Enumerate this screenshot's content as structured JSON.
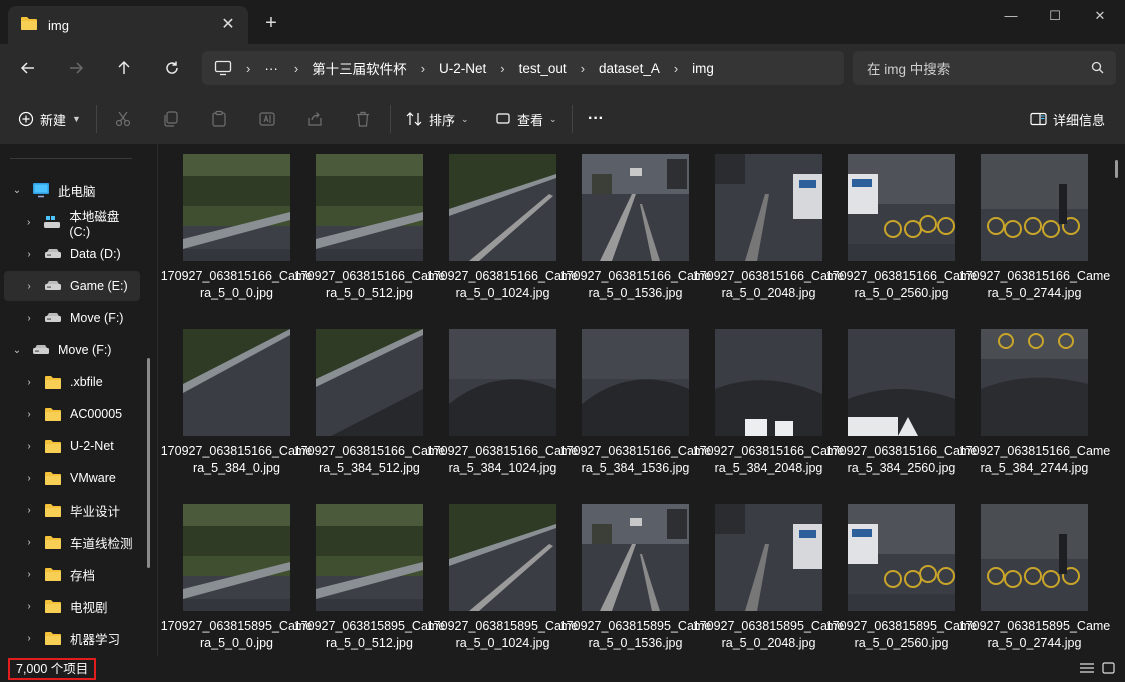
{
  "window": {
    "tab_title": "img",
    "close_tab": "✕",
    "new_tab": "+",
    "minimize": "—",
    "maximize": "☐",
    "close": "✕"
  },
  "address": {
    "more": "···",
    "breadcrumbs": [
      "第十三届软件杯",
      "U-2-Net",
      "test_out",
      "dataset_A",
      "img"
    ],
    "separator": "›"
  },
  "search": {
    "placeholder": "在 img 中搜索"
  },
  "toolbar": {
    "new_label": "新建",
    "sort_label": "排序",
    "view_label": "查看",
    "more": "···",
    "details_label": "详细信息"
  },
  "sidebar": {
    "items": [
      {
        "label": "此电脑",
        "chev": "⌄",
        "icon": "computer"
      },
      {
        "label": "本地磁盘 (C:)",
        "chev": "›",
        "icon": "win-drive"
      },
      {
        "label": "Data (D:)",
        "chev": "›",
        "icon": "drive"
      },
      {
        "label": "Game (E:)",
        "chev": "›",
        "icon": "drive"
      },
      {
        "label": "Move (F:)",
        "chev": "›",
        "icon": "drive"
      },
      {
        "label": "Move (F:)",
        "chev": "⌄",
        "icon": "drive"
      },
      {
        "label": ".xbfile",
        "chev": "›",
        "icon": "folder"
      },
      {
        "label": "AC00005",
        "chev": "›",
        "icon": "folder"
      },
      {
        "label": "U-2-Net",
        "chev": "›",
        "icon": "folder"
      },
      {
        "label": "VMware",
        "chev": "›",
        "icon": "folder"
      },
      {
        "label": "毕业设计",
        "chev": "›",
        "icon": "folder"
      },
      {
        "label": "车道线检测",
        "chev": "›",
        "icon": "folder"
      },
      {
        "label": "存档",
        "chev": "›",
        "icon": "folder"
      },
      {
        "label": "电视剧",
        "chev": "›",
        "icon": "folder"
      },
      {
        "label": "机器学习",
        "chev": "›",
        "icon": "folder"
      }
    ]
  },
  "files": [
    {
      "name": "170927_063815166_Camera_5_0_0.jpg",
      "scene": "grass"
    },
    {
      "name": "170927_063815166_Camera_5_0_512.jpg",
      "scene": "grass"
    },
    {
      "name": "170927_063815166_Camera_5_0_1024.jpg",
      "scene": "road-left"
    },
    {
      "name": "170927_063815166_Camera_5_0_1536.jpg",
      "scene": "road"
    },
    {
      "name": "170927_063815166_Camera_5_0_2048.jpg",
      "scene": "street"
    },
    {
      "name": "170927_063815166_Camera_5_0_2560.jpg",
      "scene": "bikes"
    },
    {
      "name": "170927_063815166_Camera_5_0_2744.jpg",
      "scene": "bikes2"
    },
    {
      "name": "170927_063815166_Camera_5_384_0.jpg",
      "scene": "curb"
    },
    {
      "name": "170927_063815166_Camera_5_384_512.jpg",
      "scene": "curb-hood"
    },
    {
      "name": "170927_063815166_Camera_5_384_1024.jpg",
      "scene": "hood"
    },
    {
      "name": "170927_063815166_Camera_5_384_1536.jpg",
      "scene": "hood"
    },
    {
      "name": "170927_063815166_Camera_5_384_2048.jpg",
      "scene": "hood-light"
    },
    {
      "name": "170927_063815166_Camera_5_384_2560.jpg",
      "scene": "hood-light2"
    },
    {
      "name": "170927_063815166_Camera_5_384_2744.jpg",
      "scene": "hood-bikes"
    },
    {
      "name": "170927_063815895_Camera_5_0_0.jpg",
      "scene": "grass"
    },
    {
      "name": "170927_063815895_Camera_5_0_512.jpg",
      "scene": "grass"
    },
    {
      "name": "170927_063815895_Camera_5_0_1024.jpg",
      "scene": "road-left"
    },
    {
      "name": "170927_063815895_Camera_5_0_1536.jpg",
      "scene": "road"
    },
    {
      "name": "170927_063815895_Camera_5_0_2048.jpg",
      "scene": "street"
    },
    {
      "name": "170927_063815895_Camera_5_0_2560.jpg",
      "scene": "bikes"
    },
    {
      "name": "170927_063815895_Camera_5_0_2744.jpg",
      "scene": "bikes2"
    }
  ],
  "status": {
    "count": "7,000 个项目"
  },
  "colors": {
    "folder": "#f3c13a",
    "highlight": "#e21d1d",
    "accent": "#4cc2ff"
  }
}
